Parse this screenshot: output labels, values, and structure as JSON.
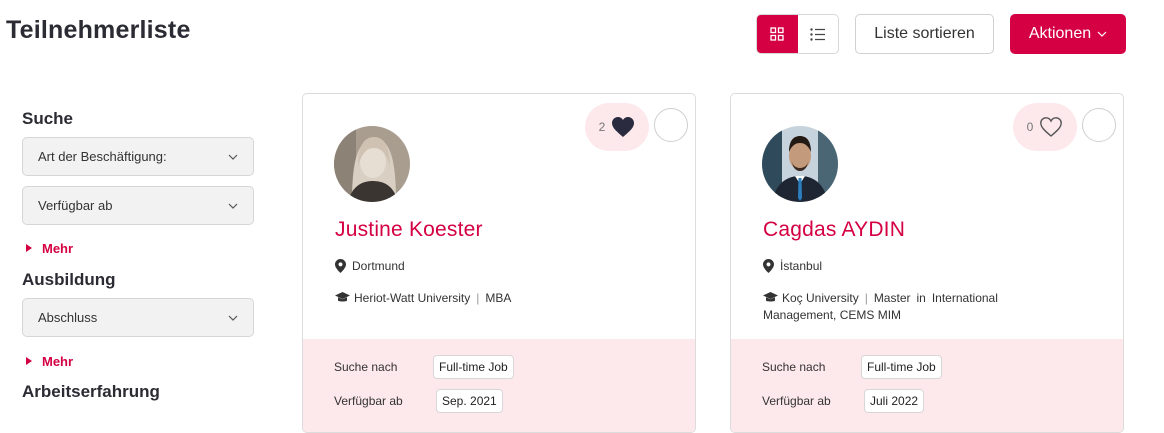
{
  "header": {
    "title": "Teilnehmerliste",
    "sort_label": "Liste sortieren",
    "actions_label": "Aktionen",
    "accent_color": "#d40043"
  },
  "sidebar": {
    "search_title": "Suche",
    "employment_dropdown": "Art der Beschäftigung:",
    "available_dropdown": "Verfügbar ab",
    "more_label_1": "Mehr",
    "education_title": "Ausbildung",
    "degree_dropdown": "Abschluss",
    "more_label_2": "Mehr",
    "experience_title": "Arbeitserfahrung"
  },
  "cards": [
    {
      "like_count": "2",
      "liked": true,
      "name": "Justine Koester",
      "location": "Dortmund",
      "university": "Heriot-Watt University",
      "sep": "|",
      "degree": "MBA",
      "seeking_label": "Suche nach",
      "seeking_value": "Full-time Job",
      "available_label": "Verfügbar ab",
      "available_value": "Sep. 2021"
    },
    {
      "like_count": "0",
      "liked": false,
      "name": "Cagdas AYDIN",
      "location": "İstanbul",
      "university": "Koç University",
      "sep": "|",
      "degree": "Master",
      "in_word": "in",
      "field": "International Management, CEMS MIM",
      "seeking_label": "Suche nach",
      "seeking_value": "Full-time Job",
      "available_label": "Verfügbar ab",
      "available_value": "Juli 2022"
    }
  ]
}
